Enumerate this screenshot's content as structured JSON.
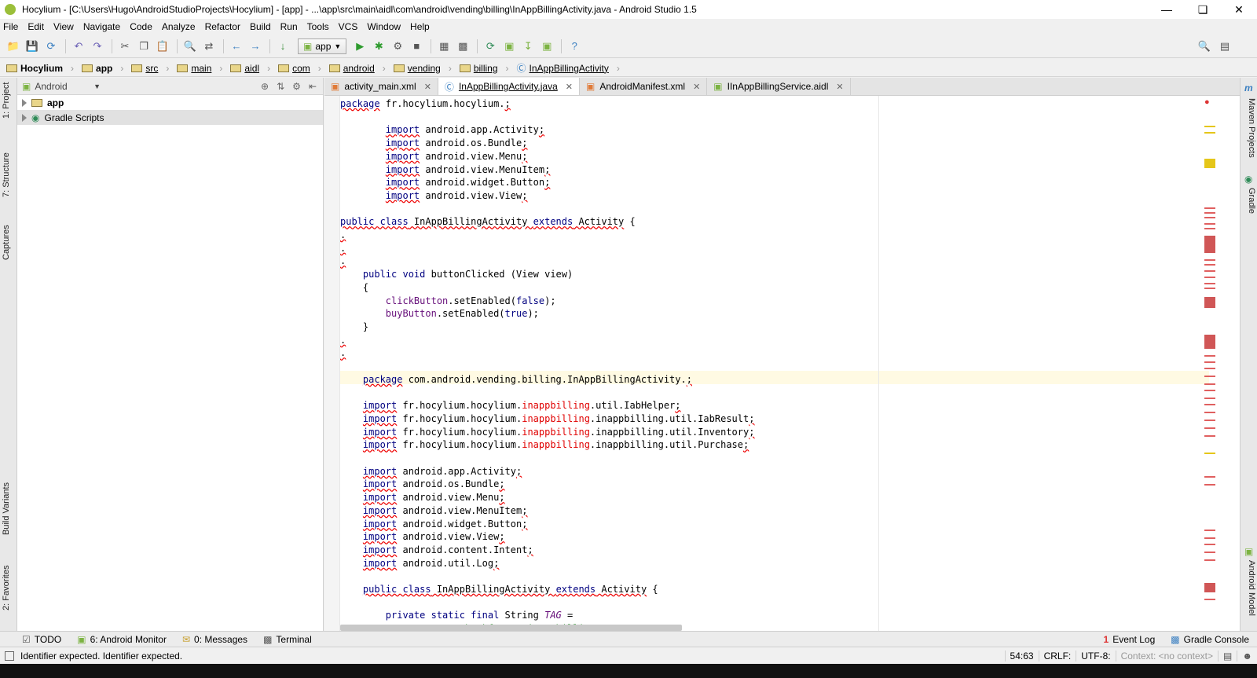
{
  "window": {
    "title": "Hocylium - [C:\\Users\\Hugo\\AndroidStudioProjects\\Hocylium] - [app] - ...\\app\\src\\main\\aidl\\com\\android\\vending\\billing\\InAppBillingActivity.java - Android Studio 1.5"
  },
  "menu": [
    "File",
    "Edit",
    "View",
    "Navigate",
    "Code",
    "Analyze",
    "Refactor",
    "Build",
    "Run",
    "Tools",
    "VCS",
    "Window",
    "Help"
  ],
  "toolbar": {
    "run_config": "app"
  },
  "breadcrumb": [
    "Hocylium",
    "app",
    "src",
    "main",
    "aidl",
    "com",
    "android",
    "vending",
    "billing",
    "InAppBillingActivity"
  ],
  "left_tool_tabs": [
    "1: Project",
    "7: Structure",
    "Captures",
    "Build Variants",
    "2: Favorites"
  ],
  "right_tool_tabs": [
    "Maven Projects",
    "Gradle",
    "Android Model"
  ],
  "project_panel": {
    "view_mode": "Android",
    "items": [
      "app",
      "Gradle Scripts"
    ]
  },
  "editor_tabs": [
    "activity_main.xml",
    "InAppBillingActivity.java",
    "AndroidManifest.xml",
    "IInAppBillingService.aidl"
  ],
  "bottom_tools": [
    "TODO",
    "6: Android Monitor",
    "0: Messages",
    "Terminal"
  ],
  "bottom_tools_right": [
    "Event Log",
    "Gradle Console"
  ],
  "event_log_count": "1",
  "status": {
    "message": "Identifier expected. Identifier expected.",
    "position": "54:63",
    "line_sep": "CRLF:",
    "encoding": "UTF-8:",
    "context": "Context: <no context>"
  }
}
